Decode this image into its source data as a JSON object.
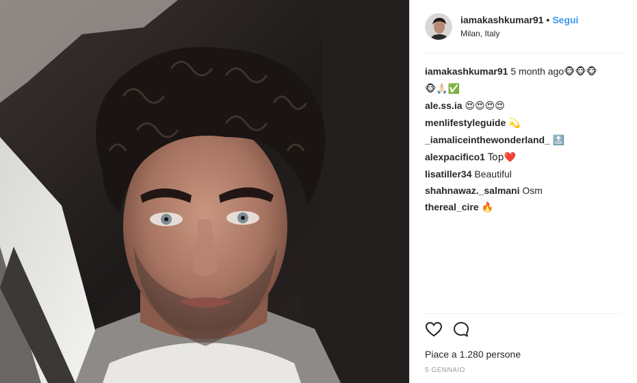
{
  "post": {
    "author": "iamakashkumar91",
    "follow_label": "Segui",
    "location": "Milan, Italy",
    "caption": {
      "user": "iamakashkumar91",
      "time": "5 month ago",
      "text_line1": "🐵🐵🐵",
      "text_line2": "🐵🙏🏻✅"
    },
    "comments": [
      {
        "user": "ale.ss.ia",
        "text": "😍😍😍😍"
      },
      {
        "user": "menlifestyleguide",
        "text": "💫"
      },
      {
        "user": "_iamaliceinthewonderland_",
        "text": "🔝"
      },
      {
        "user": "alexpacifico1",
        "text": "Top❤️"
      },
      {
        "user": "lisatiller34",
        "text": "Beautiful"
      },
      {
        "user": "shahnawaz._salmani",
        "text": "Osm"
      },
      {
        "user": "thereal_cire",
        "text": "🔥"
      }
    ],
    "likes_text": "Piace a 1.280 persone",
    "date": "5 GENNAIO",
    "icons": {
      "like": "heart-icon",
      "comment": "comment-icon"
    },
    "colors": {
      "link": "#3897f0",
      "text": "#262626",
      "muted": "#999999"
    }
  }
}
